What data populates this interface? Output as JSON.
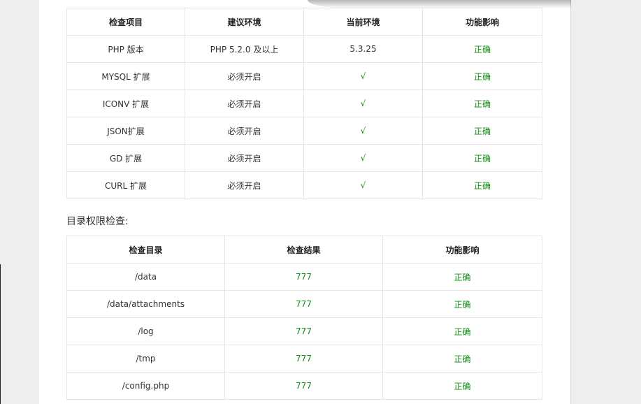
{
  "env_check": {
    "headers": [
      "检查项目",
      "建议环境",
      "当前环境",
      "功能影响"
    ],
    "rows": [
      {
        "item": "PHP 版本",
        "recommended": "PHP 5.2.0 及以上",
        "current": "5.3.25",
        "effect": "正确"
      },
      {
        "item": "MYSQL 扩展",
        "recommended": "必须开启",
        "current": "√",
        "effect": "正确"
      },
      {
        "item": "ICONV 扩展",
        "recommended": "必须开启",
        "current": "√",
        "effect": "正确"
      },
      {
        "item": "JSON扩展",
        "recommended": "必须开启",
        "current": "√",
        "effect": "正确"
      },
      {
        "item": "GD 扩展",
        "recommended": "必须开启",
        "current": "√",
        "effect": "正确"
      },
      {
        "item": "CURL 扩展",
        "recommended": "必须开启",
        "current": "√",
        "effect": "正确"
      }
    ]
  },
  "dir_check": {
    "title": "目录权限检查:",
    "headers": [
      "检查目录",
      "检查结果",
      "功能影响"
    ],
    "rows": [
      {
        "dir": "/data",
        "result": "777",
        "effect": "正确"
      },
      {
        "dir": "/data/attachments",
        "result": "777",
        "effect": "正确"
      },
      {
        "dir": "/log",
        "result": "777",
        "effect": "正确"
      },
      {
        "dir": "/tmp",
        "result": "777",
        "effect": "正确"
      },
      {
        "dir": "/config.php",
        "result": "777",
        "effect": "正确"
      }
    ]
  },
  "colors": {
    "ok": "#118e11",
    "border": "#e6e6e6",
    "background": "#efeeef"
  }
}
